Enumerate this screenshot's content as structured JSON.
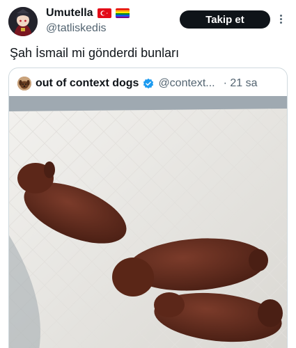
{
  "author": {
    "display_name": "Umutella",
    "handle": "@tatliskedis",
    "flags": [
      "turkey-flag-icon",
      "rainbow-flag-icon"
    ]
  },
  "actions": {
    "follow_label": "Takip et",
    "more_icon": "more-options-icon"
  },
  "tweet": {
    "text": "Şah İsmail mi gönderdi bunları"
  },
  "quoted": {
    "name": "out of context dogs",
    "verified": true,
    "handle": "@context...",
    "time": "· 21 sa",
    "media_description_icon": "photo-of-three-brown-puppies-on-pad"
  },
  "colors": {
    "follow_bg": "#0f1419",
    "verified_blue": "#1d9bf0",
    "secondary_text": "#536471"
  }
}
